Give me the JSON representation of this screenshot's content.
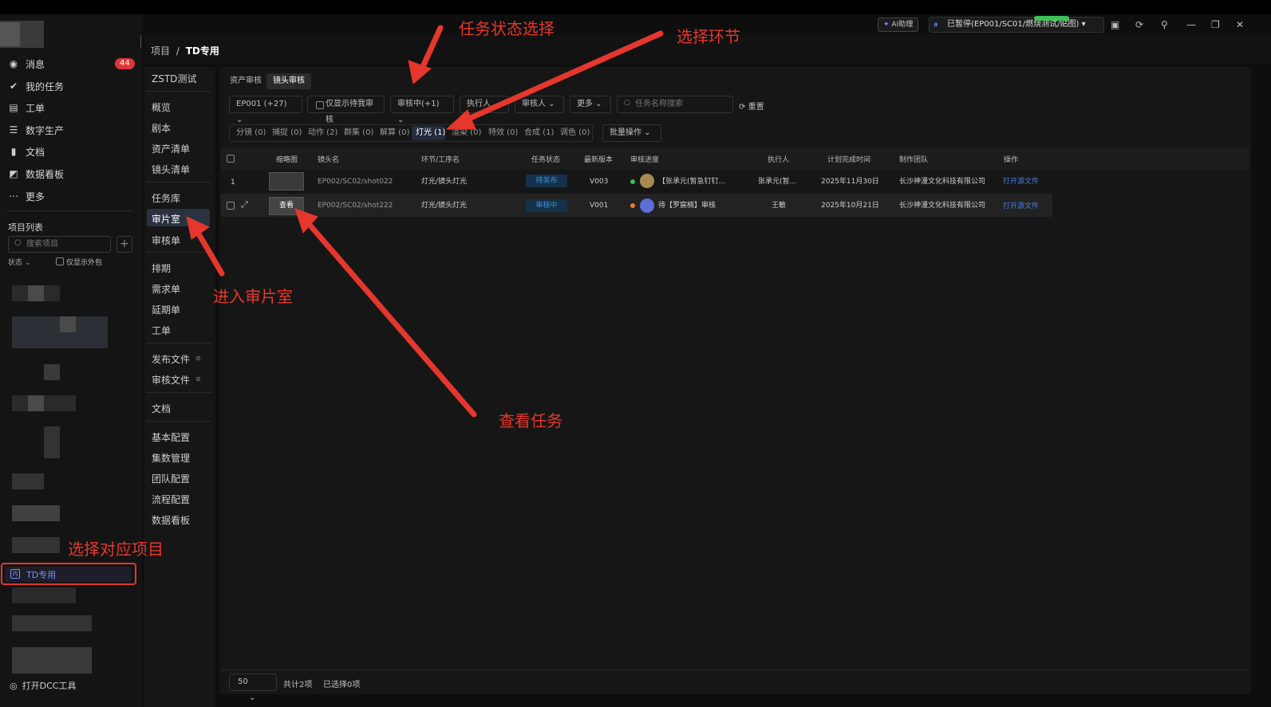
{
  "sidebar": {
    "items": [
      {
        "label": "消息",
        "icon": "bell-icon"
      },
      {
        "label": "我的任务",
        "icon": "check-icon"
      },
      {
        "label": "工单",
        "icon": "ticket-icon"
      },
      {
        "label": "数字生产",
        "icon": "list-icon"
      },
      {
        "label": "文档",
        "icon": "book-icon"
      },
      {
        "label": "数据看板",
        "icon": "chart-icon"
      },
      {
        "label": "更多",
        "icon": "more-icon"
      }
    ],
    "message_badge": "44",
    "project_list_title": "项目列表",
    "search_placeholder": "搜索项目",
    "status_filter": "状态",
    "only_outsource": "仅显示外包",
    "selected_project": "TD专用",
    "dcc_tool": "打开DCC工具"
  },
  "topbar": {
    "ai_button": "AI助理",
    "paused_task": "已暂停(EP001/SC01/燃烧测试/贴图)"
  },
  "breadcrumb": {
    "root": "项目",
    "sep": "/",
    "current": "TD专用"
  },
  "nav2": {
    "project_name": "ZSTD测试",
    "group1": [
      "概览",
      "剧本",
      "资产清单",
      "镜头清单"
    ],
    "group2": [
      "任务库",
      "审片室",
      "审核单"
    ],
    "group3": [
      "排期",
      "需求单",
      "延期单",
      "工单"
    ],
    "group4": [
      "发布文件",
      "审核文件"
    ],
    "group5": [
      "文档"
    ],
    "group6": [
      "基本配置",
      "集数管理",
      "团队配置",
      "流程配置",
      "数据看板"
    ]
  },
  "tabs": [
    "资产审核",
    "镜头审核"
  ],
  "filters": {
    "episode": "EP001 (+27)",
    "only_pending": "仅显示待我审核",
    "status": "审核中(+1)",
    "executor": "执行人",
    "reviewer": "审核人",
    "more": "更多",
    "search_placeholder": "任务名称搜索",
    "reset": "重置"
  },
  "stages": [
    "分镜 (0)",
    "捕捉 (0)",
    "动作 (2)",
    "群集 (0)",
    "解算 (0)",
    "灯光 (1)",
    "渲染 (0)",
    "特效 (0)",
    "合成 (1)",
    "调色 (0)"
  ],
  "batch_button": "批量操作",
  "table": {
    "headers": [
      "缩略图",
      "镜头名",
      "环节/工序名",
      "任务状态",
      "最新版本",
      "审核进度",
      "执行人",
      "计划完成时间",
      "制作团队",
      "操作"
    ],
    "rows": [
      {
        "index": "1",
        "shot": "EP002/SC02/shot022",
        "step": "灯光/镜头灯光",
        "status": "待发布",
        "version": "V003",
        "progress": "【张承元(暂急钉钉...",
        "executor": "张承元(暂...",
        "due": "2025年11月30日",
        "team": "长沙神漫文化科技有限公司",
        "action": "打开源文件",
        "dot_color": "#2fc24f"
      },
      {
        "index": "",
        "shot": "EP002/SC02/shot222",
        "step": "灯光/镜头灯光",
        "status": "审核中",
        "version": "V001",
        "progress": "待【罗宸楠】审核",
        "executor": "王敏",
        "due": "2025年10月21日",
        "team": "长沙神漫文化科技有限公司",
        "action": "打开源文件",
        "dot_color": "#f07d1a",
        "thumb_label": "查看"
      }
    ]
  },
  "footer": {
    "page_size": "50",
    "total": "共计2项",
    "selected": "已选择0项"
  },
  "annotations": {
    "status_select": "任务状态选择",
    "select_step": "选择环节",
    "enter_review": "进入审片室",
    "view_task": "查看任务",
    "select_project": "选择对应项目"
  },
  "colors": {
    "accent_red": "#e5372d",
    "link": "#4a7fe0",
    "status_blue": "#3a8fd6"
  }
}
